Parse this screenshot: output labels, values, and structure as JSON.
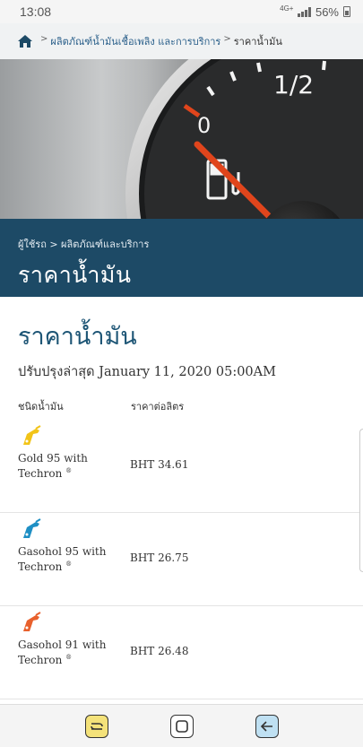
{
  "status_bar": {
    "time": "13:08",
    "network": "4G+",
    "battery": "56%"
  },
  "breadcrumb": {
    "home_icon": "home-icon",
    "items": [
      "ผลิตภัณฑ์น้ำมันเชื้อเพลิง และการบริการ"
    ],
    "current": "ราคาน้ำมัน",
    "separator": ">"
  },
  "hero": {
    "gauge_label": "1/2",
    "gauge_empty": "0",
    "icon": "fuel-pump-icon"
  },
  "title_band": {
    "crumb": "ผู้ใช้รถ > ผลิตภัณฑ์และบริการ",
    "title": "ราคาน้ำมัน"
  },
  "main": {
    "title": "ราคาน้ำมัน",
    "updated": "ปรับปรุงล่าสุด January 11, 2020 05:00AM",
    "col_type": "ชนิดน้ำมัน",
    "col_price": "ราคาต่อลิตร",
    "fuels": [
      {
        "name_line1": "Gold 95 with",
        "name_line2": "Techron",
        "reg": "®",
        "price": "BHT 34.61",
        "color": "#f2c418"
      },
      {
        "name_line1": "Gasohol 95 with",
        "name_line2": "Techron",
        "reg": "®",
        "price": "BHT 26.75",
        "color": "#1e8fc4"
      },
      {
        "name_line1": "Gasohol 91 with",
        "name_line2": "Techron",
        "reg": "®",
        "price": "BHT 26.48",
        "color": "#e8602c"
      }
    ]
  },
  "nav": {
    "recent": "recent-apps-icon",
    "home": "home-button-icon",
    "back": "back-icon"
  },
  "colors": {
    "band": "#1d4a66",
    "title": "#1d5575",
    "needle": "#e0451c"
  }
}
